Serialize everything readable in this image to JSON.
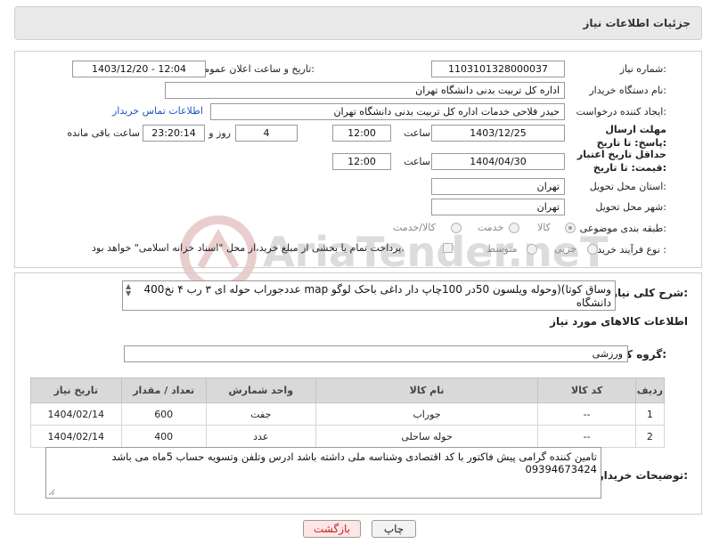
{
  "panel_title": "جزئیات اطلاعات نیاز",
  "labels": {
    "need_number": "شماره نیاز:",
    "announce_datetime": "تاریخ و ساعت اعلان عمومی:",
    "buyer_org": "نام دستگاه خریدار:",
    "requester": "ایجاد کننده درخواست:",
    "reply_deadline": "مهلت ارسال پاسخ: تا تاریخ:",
    "price_validity": "حداقل تاریخ اعتبار قیمت: تا تاریخ:",
    "delivery_province": "استان محل تحویل:",
    "delivery_city": "شهر محل تحویل:",
    "subject_category": "طبقه بندی موضوعی:",
    "purchase_type": "نوع فرآیند خرید :",
    "time_word": "ساعت",
    "day_and": "روز و",
    "remaining_time": "ساعت باقی مانده",
    "general_desc": "شرح کلی نیاز:",
    "goods_info": "اطلاعات کالاهای مورد نیاز",
    "goods_group": "گروه کالا:",
    "buyer_notes": "توضیحات خریدار:"
  },
  "values": {
    "need_number": "1103101328000037",
    "announce_datetime": "1403/12/20 - 12:04",
    "buyer_org": "اداره کل تربیت بدنی دانشگاه تهران",
    "requester": "حیدر فلاحی خدمات اداره کل تربیت بدنی دانشگاه تهران",
    "contact_link": "اطلاعات تماس خریدار",
    "reply_date": "1403/12/25",
    "reply_time": "12:00",
    "days": "4",
    "remaining": "23:20:14",
    "validity_date": "1404/04/30",
    "validity_time": "12:00",
    "province": "تهران",
    "city": "تهران",
    "general_desc": "400عددجوراب حوله ای ۳ رب ۴ نخ map وساق کوتا)(وحوله ویلسون 50در 100چاپ دار داغی باحک لوگو دانشگاه",
    "goods_group": "ورزشی",
    "buyer_notes": "تامین کننده گرامی پیش فاکتور با کد اقتصادی وشناسه ملی داشته باشد ادرس وتلفن وتسویه حساب 5ماه می باشد 09394673424"
  },
  "category_options": [
    {
      "label": "کالا",
      "selected": true
    },
    {
      "label": "خدمت",
      "selected": false
    },
    {
      "label": "کالا/خدمت",
      "selected": false
    }
  ],
  "purchase_options": [
    {
      "label": "جزیی",
      "selected": false
    },
    {
      "label": "متوسط",
      "selected": false
    }
  ],
  "treasury_note": "پرداخت تمام یا بخشی از مبلغ خرید،از محل \"اسناد خزانه اسلامی\" خواهد بود.",
  "table": {
    "headers": [
      "ردیف",
      "کد کالا",
      "نام کالا",
      "واحد شمارش",
      "تعداد / مقدار",
      "تاریخ نیاز"
    ],
    "rows": [
      {
        "idx": "1",
        "code": "--",
        "name": "جوراب",
        "unit": "جفت",
        "qty": "600",
        "date": "1404/02/14"
      },
      {
        "idx": "2",
        "code": "--",
        "name": "حوله ساحلی",
        "unit": "عدد",
        "qty": "400",
        "date": "1404/02/14"
      }
    ]
  },
  "buttons": {
    "print": "چاپ",
    "back": "بازگشت"
  },
  "watermark": "AriaTender.neT",
  "colors": {
    "link": "#1a58c4",
    "back_button_text": "#cc2222",
    "print_button_bg": "#f3f3f3",
    "back_button_bg": "#fde6e6"
  }
}
